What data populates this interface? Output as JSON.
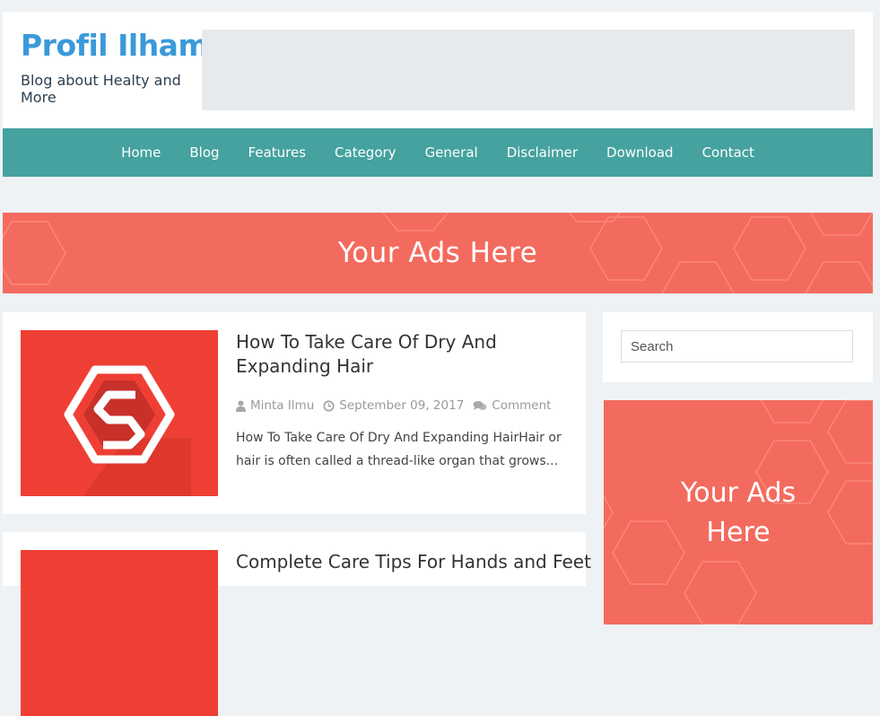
{
  "header": {
    "site_title": "Profil Ilham",
    "site_description": "Blog about Healty and More"
  },
  "nav": {
    "items": [
      "Home",
      "Blog",
      "Features",
      "Category",
      "General",
      "Disclaimer",
      "Download",
      "Contact"
    ]
  },
  "banner_ad": {
    "text": "Your Ads Here"
  },
  "posts": [
    {
      "title": "How To Take Care Of Dry And Expanding Hair",
      "author": "Minta Ilmu",
      "date": "September 09, 2017",
      "comments": "Comment",
      "excerpt": "How To Take Care Of Dry And Expanding HairHair or hair is often called a thread-like organ that grows..."
    },
    {
      "title": "Complete Care Tips For Hands and Feet"
    }
  ],
  "sidebar": {
    "search_placeholder": "Search",
    "ad": {
      "line1": "Your Ads",
      "line2": "Here"
    }
  },
  "colors": {
    "brand": "#3a9ad9",
    "nav": "#45a29f",
    "ad": "#f36b5e",
    "thumbnail": "#ef3f35"
  },
  "icons": {
    "author": "user-icon",
    "date": "clock-icon",
    "comments": "comments-icon",
    "thumbnail": "s-logo-icon"
  }
}
